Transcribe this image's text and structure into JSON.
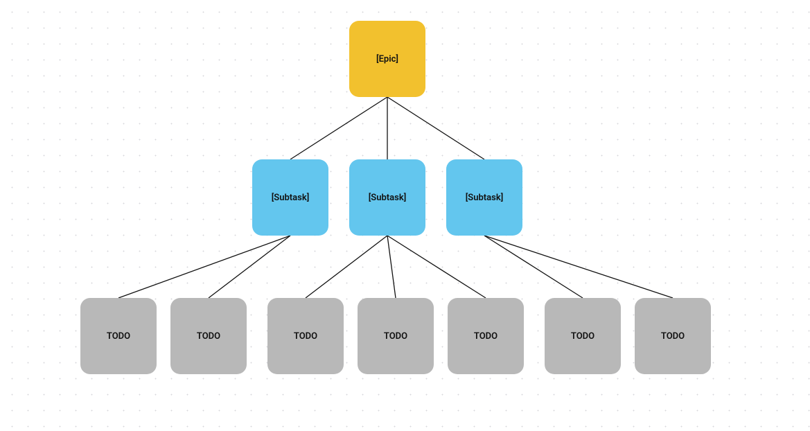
{
  "diagram": {
    "epic": {
      "label": "[Epic]"
    },
    "subtasks": [
      {
        "label": "[Subtask]"
      },
      {
        "label": "[Subtask]"
      },
      {
        "label": "[Subtask]"
      }
    ],
    "todos": [
      {
        "label": "TODO"
      },
      {
        "label": "TODO"
      },
      {
        "label": "TODO"
      },
      {
        "label": "TODO"
      },
      {
        "label": "TODO"
      },
      {
        "label": "TODO"
      },
      {
        "label": "TODO"
      }
    ],
    "colors": {
      "epic": "#f2c12e",
      "subtask": "#63c6ee",
      "todo": "#b8b8b8"
    }
  }
}
